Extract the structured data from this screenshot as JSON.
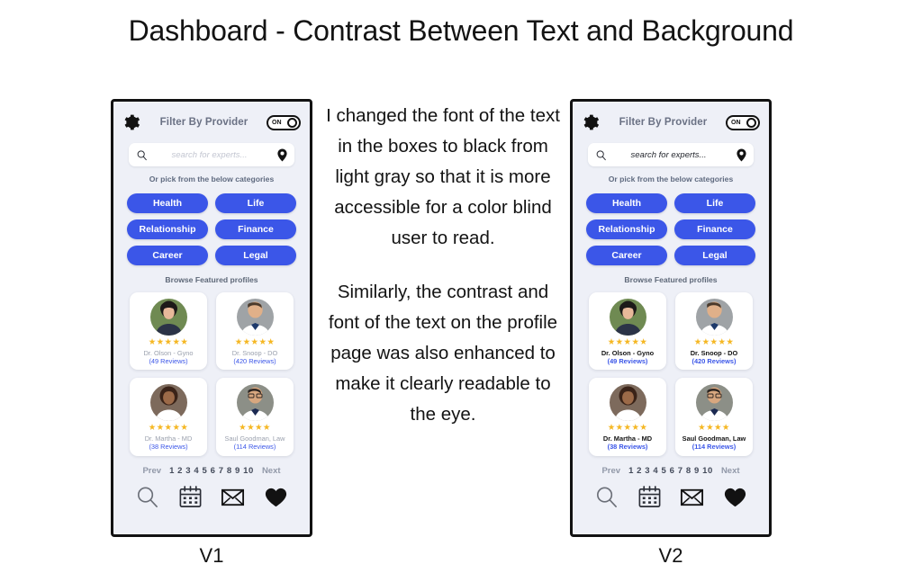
{
  "title": "Dashboard - Contrast Between Text and Background",
  "colors": {
    "accent_blue": "#3b56e8",
    "star_gold": "#f5b722",
    "phone_bg": "#eef0f7",
    "v1_muted_text": "#9ba1ae",
    "v2_text": "#141414"
  },
  "notes": [
    "I changed the font of the text in the boxes to black from light gray so that it is more accessible for a color blind user to read.",
    "Similarly, the contrast and font of the text on the profile page was also enhanced to make it clearly readable to the eye."
  ],
  "phone": {
    "header": {
      "gear_icon": "gear-icon",
      "title": "Filter By Provider",
      "toggle_label": "ON"
    },
    "search": {
      "icon": "search-icon",
      "placeholder": "search for experts...",
      "pin_icon": "location-pin-icon"
    },
    "subhead": "Or pick from the below categories",
    "categories": [
      "Health",
      "Life",
      "Relationship",
      "Finance",
      "Career",
      "Legal"
    ],
    "browse_label": "Browse Featured profiles",
    "profiles": [
      {
        "name": "Dr. Olson - Gyno",
        "reviews": "(49 Reviews)",
        "stars": 5
      },
      {
        "name": "Dr. Snoop - DO",
        "reviews": "(420 Reviews)",
        "stars": 5
      },
      {
        "name": "Dr. Martha - MD",
        "reviews": "(38 Reviews)",
        "stars": 5
      },
      {
        "name": "Saul Goodman, Law",
        "reviews": "(114 Reviews)",
        "stars": 4
      }
    ],
    "pagination": {
      "prev": "Prev",
      "numbers": "1 2 3 4 5 6 7 8 9 10",
      "next": "Next"
    },
    "bottom_nav": [
      "search-icon",
      "calendar-icon",
      "envelope-icon",
      "heart-icon"
    ]
  },
  "captions": {
    "v1": "V1",
    "v2": "V2"
  }
}
